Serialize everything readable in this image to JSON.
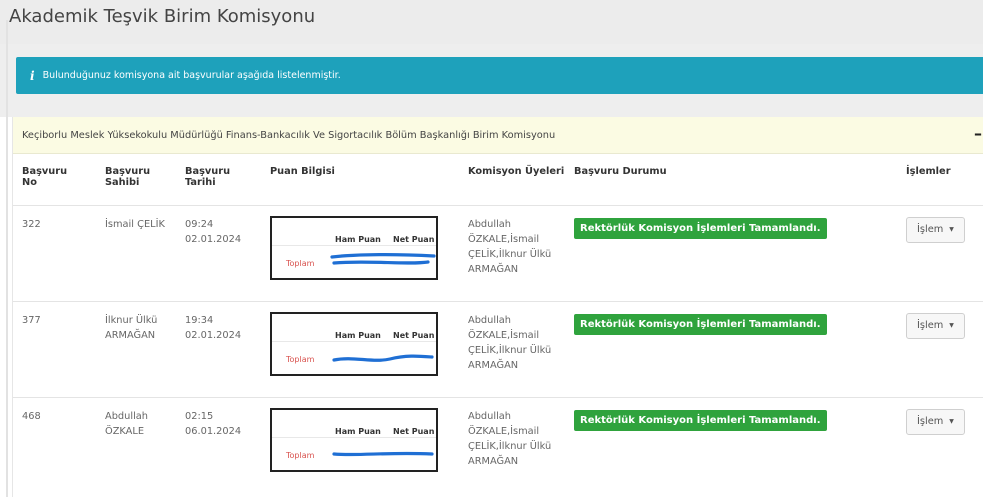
{
  "page": {
    "title": "Akademik Teşvik Birim Komisyonu"
  },
  "alert": {
    "icon": "info-icon",
    "text": "Bulunduğunuz komisyona ait başvurular aşağıda listelenmiştir."
  },
  "colors": {
    "alert_bg": "#1ea1bb",
    "card_header_bg": "#fbfbe3",
    "status_green": "#2fa33d",
    "total_red": "#d9534f",
    "scribble_blue": "#1f6fd4"
  },
  "card": {
    "title": "Keçiborlu Meslek Yüksekokulu Müdürlüğü Finans-Bankacılık Ve Sigortacılık Bölüm Başkanlığı Birim Komisyonu",
    "collapse_label": "–"
  },
  "table": {
    "headers": {
      "no": "Başvuru No",
      "owner": "Başvuru Sahibi",
      "date": "Başvuru Tarihi",
      "score": "Puan Bilgisi",
      "members": "Komisyon Üyeleri",
      "status": "Başvuru Durumu",
      "actions": "İşlemler"
    },
    "score_labels": {
      "raw": "Ham Puan",
      "net": "Net Puan",
      "total": "Toplam"
    },
    "action_label": "İşlem",
    "rows": [
      {
        "no": "322",
        "owner_line1": "İsmail ÇELİK",
        "owner_line2": "",
        "time": "09:24",
        "date": "02.01.2024",
        "members": [
          "Abdullah",
          "ÖZKALE,İsmail",
          "ÇELİK,İlknur Ülkü",
          "ARMAĞAN"
        ],
        "status": "Rektörlük Komisyon İşlemleri Tamamlandı."
      },
      {
        "no": "377",
        "owner_line1": "İlknur Ülkü",
        "owner_line2": "ARMAĞAN",
        "time": "19:34",
        "date": "02.01.2024",
        "members": [
          "Abdullah",
          "ÖZKALE,İsmail",
          "ÇELİK,İlknur Ülkü",
          "ARMAĞAN"
        ],
        "status": "Rektörlük Komisyon İşlemleri Tamamlandı."
      },
      {
        "no": "468",
        "owner_line1": "Abdullah",
        "owner_line2": "ÖZKALE",
        "time": "02:15",
        "date": "06.01.2024",
        "members": [
          "Abdullah",
          "ÖZKALE,İsmail",
          "ÇELİK,İlknur Ülkü",
          "ARMAĞAN"
        ],
        "status": "Rektörlük Komisyon İşlemleri Tamamlandı."
      }
    ]
  }
}
